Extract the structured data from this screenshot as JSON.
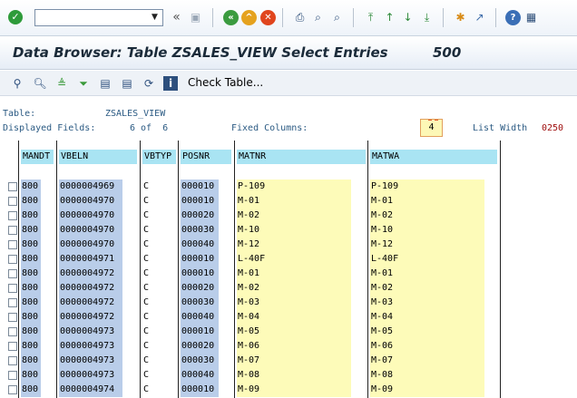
{
  "toolbar": {
    "command_value": "",
    "icons": [
      "enter-icon",
      "back-icon",
      "exit-icon",
      "cancel-icon",
      "print-icon",
      "find-icon",
      "find-next-icon",
      "first-page-icon",
      "previous-page-icon",
      "next-page-icon",
      "last-page-icon",
      "create-session-icon",
      "shortcut-icon",
      "help-icon",
      "customize-icon"
    ]
  },
  "title": {
    "text": "Data Browser: Table ZSALES_VIEW Select Entries",
    "count": "500"
  },
  "app_toolbar": {
    "check_table_label": "Check Table..."
  },
  "info": {
    "table_label": "Table:",
    "table_value": "ZSALES_VIEW",
    "displayed_label": "Displayed Fields:",
    "displayed_value": "6 of  6",
    "fixed_label": "Fixed Columns:",
    "fixed_value": "4",
    "list_width_label": "List Width",
    "list_width_value": "0250"
  },
  "columns": [
    "MANDT",
    "VBELN",
    "VBTYP",
    "POSNR",
    "MATNR",
    "MATWA"
  ],
  "rows": [
    {
      "mandt": "800",
      "vbeln": "0000004969",
      "vbtyp": "C",
      "posnr": "000010",
      "matnr": "P-109",
      "matwa": "P-109"
    },
    {
      "mandt": "800",
      "vbeln": "0000004970",
      "vbtyp": "C",
      "posnr": "000010",
      "matnr": "M-01",
      "matwa": "M-01"
    },
    {
      "mandt": "800",
      "vbeln": "0000004970",
      "vbtyp": "C",
      "posnr": "000020",
      "matnr": "M-02",
      "matwa": "M-02"
    },
    {
      "mandt": "800",
      "vbeln": "0000004970",
      "vbtyp": "C",
      "posnr": "000030",
      "matnr": "M-10",
      "matwa": "M-10"
    },
    {
      "mandt": "800",
      "vbeln": "0000004970",
      "vbtyp": "C",
      "posnr": "000040",
      "matnr": "M-12",
      "matwa": "M-12"
    },
    {
      "mandt": "800",
      "vbeln": "0000004971",
      "vbtyp": "C",
      "posnr": "000010",
      "matnr": "L-40F",
      "matwa": "L-40F"
    },
    {
      "mandt": "800",
      "vbeln": "0000004972",
      "vbtyp": "C",
      "posnr": "000010",
      "matnr": "M-01",
      "matwa": "M-01"
    },
    {
      "mandt": "800",
      "vbeln": "0000004972",
      "vbtyp": "C",
      "posnr": "000020",
      "matnr": "M-02",
      "matwa": "M-02"
    },
    {
      "mandt": "800",
      "vbeln": "0000004972",
      "vbtyp": "C",
      "posnr": "000030",
      "matnr": "M-03",
      "matwa": "M-03"
    },
    {
      "mandt": "800",
      "vbeln": "0000004972",
      "vbtyp": "C",
      "posnr": "000040",
      "matnr": "M-04",
      "matwa": "M-04"
    },
    {
      "mandt": "800",
      "vbeln": "0000004973",
      "vbtyp": "C",
      "posnr": "000010",
      "matnr": "M-05",
      "matwa": "M-05"
    },
    {
      "mandt": "800",
      "vbeln": "0000004973",
      "vbtyp": "C",
      "posnr": "000020",
      "matnr": "M-06",
      "matwa": "M-06"
    },
    {
      "mandt": "800",
      "vbeln": "0000004973",
      "vbtyp": "C",
      "posnr": "000030",
      "matnr": "M-07",
      "matwa": "M-07"
    },
    {
      "mandt": "800",
      "vbeln": "0000004973",
      "vbtyp": "C",
      "posnr": "000040",
      "matnr": "M-08",
      "matwa": "M-08"
    },
    {
      "mandt": "800",
      "vbeln": "0000004974",
      "vbtyp": "C",
      "posnr": "000010",
      "matnr": "M-09",
      "matwa": "M-09"
    }
  ]
}
